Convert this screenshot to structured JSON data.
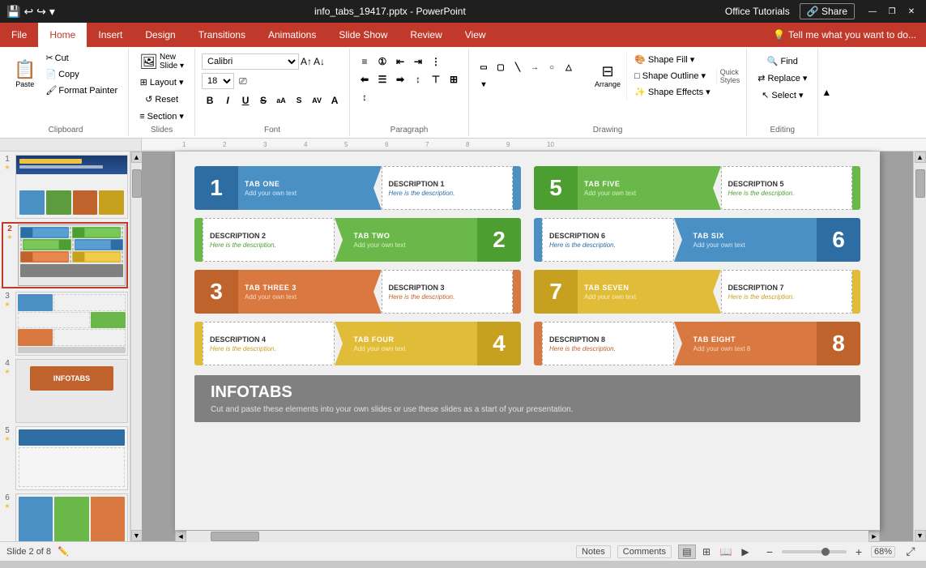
{
  "titleBar": {
    "title": "info_tabs_19417.pptx - PowerPoint",
    "quickAccess": [
      "💾",
      "↩",
      "↪",
      "📷"
    ],
    "winControls": [
      "—",
      "❐",
      "✕"
    ]
  },
  "ribbon": {
    "tabs": [
      "File",
      "Home",
      "Insert",
      "Design",
      "Transitions",
      "Animations",
      "Slide Show",
      "Review",
      "View"
    ],
    "activeTab": "Home",
    "appName": "Office Tutorials",
    "share": "Share",
    "tellMe": "Tell me what you want to do...",
    "groups": {
      "clipboard": {
        "label": "Clipboard",
        "buttons": [
          "Paste",
          "Cut",
          "Copy",
          "Format Painter"
        ]
      },
      "slides": {
        "label": "Slides",
        "buttons": [
          "New Slide",
          "Layout",
          "Reset",
          "Section"
        ]
      },
      "font": {
        "label": "Font",
        "fontFamily": "Calibri",
        "fontSize": "18"
      },
      "paragraph": {
        "label": "Paragraph"
      },
      "drawing": {
        "label": "Drawing",
        "shapeFill": "Shape Fill",
        "shapeOutline": "Shape Outline",
        "shapeEffects": "Shape Effects",
        "quickStyles": "Quick Styles",
        "arrange": "Arrange"
      },
      "editing": {
        "label": "Editing",
        "buttons": [
          "Find",
          "Replace",
          "Select"
        ]
      }
    }
  },
  "slides": [
    {
      "num": "1",
      "starred": true,
      "active": false
    },
    {
      "num": "2",
      "starred": true,
      "active": true
    },
    {
      "num": "3",
      "starred": true,
      "active": false
    },
    {
      "num": "4",
      "starred": true,
      "active": false
    },
    {
      "num": "5",
      "starred": true,
      "active": false
    },
    {
      "num": "6",
      "starred": true,
      "active": false
    }
  ],
  "slideContent": {
    "tabs": [
      {
        "number": "1",
        "numColor": "#2e6da4",
        "labelBg": "#4a90c4",
        "title": "TAB ONE",
        "sub": "Add your own text",
        "descTitle": "DESCRIPTION 1",
        "descSub": "Here is the description.",
        "side": "left",
        "row": 0,
        "col": 0
      },
      {
        "number": "2",
        "numColor": "#4d9e30",
        "labelBg": "#6ab84a",
        "title": "TAB TWO",
        "sub": "Add your own text",
        "descTitle": "DESCRIPTION 2",
        "descSub": "Here is the description.",
        "side": "right",
        "row": 1,
        "col": 0
      },
      {
        "number": "3",
        "numColor": "#c0622c",
        "labelBg": "#d97840",
        "title": "TAB THREE 3",
        "sub": "Add your own text",
        "descTitle": "DESCRIPTION 3",
        "descSub": "Here is the description.",
        "side": "left",
        "row": 2,
        "col": 0
      },
      {
        "number": "4",
        "numColor": "#c8a020",
        "labelBg": "#e0bc38",
        "title": "TAB FOUR",
        "sub": "Add your own text",
        "descTitle": "DESCRIPTION 4",
        "descSub": "Here is the description.",
        "side": "right",
        "row": 3,
        "col": 0
      },
      {
        "number": "5",
        "numColor": "#4d9e30",
        "labelBg": "#6ab84a",
        "title": "TAB FIVE",
        "sub": "Add your own text",
        "descTitle": "DESCRIPTION 5",
        "descSub": "Here is the description.",
        "side": "left",
        "row": 0,
        "col": 1
      },
      {
        "number": "6",
        "numColor": "#2e6da4",
        "labelBg": "#4a90c4",
        "title": "TAB SIX",
        "sub": "Add your own text",
        "descTitle": "DESCRIPTION 6",
        "descSub": "Here is the description.",
        "side": "right",
        "row": 1,
        "col": 1
      },
      {
        "number": "7",
        "numColor": "#c8a020",
        "labelBg": "#e0bc38",
        "title": "TAB SEVEN",
        "sub": "Add your own text",
        "descTitle": "DESCRIPTION 7",
        "descSub": "Here is the description.",
        "side": "left",
        "row": 2,
        "col": 1
      },
      {
        "number": "8",
        "numColor": "#c0622c",
        "labelBg": "#d97840",
        "title": "TAB EIGHT",
        "sub": "Add your own text 8",
        "descTitle": "DESCRIPTION 8",
        "descSub": "Here is the description.",
        "side": "right",
        "row": 3,
        "col": 1
      }
    ],
    "footer": {
      "title": "INFOTABS",
      "subtitle": "Cut and paste these elements into your own slides or use these slides as a start of your presentation."
    }
  },
  "statusBar": {
    "slideInfo": "Slide 2 of 8",
    "notes": "Notes",
    "comments": "Comments",
    "zoom": "68%"
  }
}
